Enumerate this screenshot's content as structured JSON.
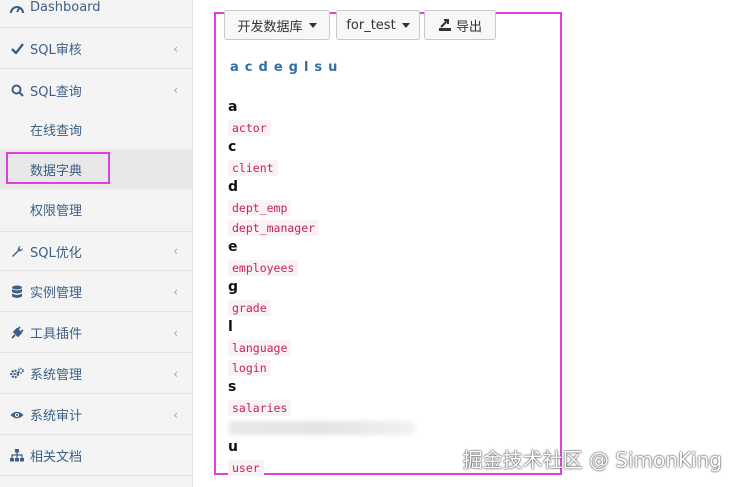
{
  "sidebar": {
    "items": [
      {
        "label": "Dashboard",
        "icon": "dashboard-icon",
        "chevron": false
      },
      {
        "label": "SQL审核",
        "icon": "check-icon",
        "chevron": true
      },
      {
        "label": "SQL查询",
        "icon": "search-icon",
        "chevron": true
      },
      {
        "label": "SQL优化",
        "icon": "wrench-icon",
        "chevron": true
      },
      {
        "label": "实例管理",
        "icon": "database-icon",
        "chevron": true
      },
      {
        "label": "工具插件",
        "icon": "plug-icon",
        "chevron": true
      },
      {
        "label": "系统管理",
        "icon": "gears-icon",
        "chevron": true
      },
      {
        "label": "系统审计",
        "icon": "eye-icon",
        "chevron": true
      },
      {
        "label": "相关文档",
        "icon": "sitemap-icon",
        "chevron": false
      }
    ],
    "sub_items": [
      {
        "label": "在线查询"
      },
      {
        "label": "数据字典",
        "active": true
      },
      {
        "label": "权限管理"
      }
    ],
    "chevron_glyph": "‹"
  },
  "toolbar": {
    "instance_label": "开发数据库",
    "db_label": "for_test",
    "export_label": "导出"
  },
  "index_letters": [
    "a",
    "c",
    "d",
    "e",
    "g",
    "l",
    "s",
    "u"
  ],
  "groups": [
    {
      "letter": "a",
      "tables": [
        "actor"
      ]
    },
    {
      "letter": "c",
      "tables": [
        "client"
      ]
    },
    {
      "letter": "d",
      "tables": [
        "dept_emp",
        "dept_manager"
      ]
    },
    {
      "letter": "e",
      "tables": [
        "employees"
      ]
    },
    {
      "letter": "g",
      "tables": [
        "grade"
      ]
    },
    {
      "letter": "l",
      "tables": [
        "language",
        "login"
      ]
    },
    {
      "letter": "s",
      "tables": [
        "salaries"
      ]
    },
    {
      "letter": "u",
      "tables": [
        "user"
      ]
    }
  ],
  "watermark": "掘金技术社区 @ SimonKing",
  "colors": {
    "highlight": "#e040e0",
    "link": "#2f6fa7",
    "code": "#c2255c",
    "code_bg": "#f9f2f4"
  }
}
